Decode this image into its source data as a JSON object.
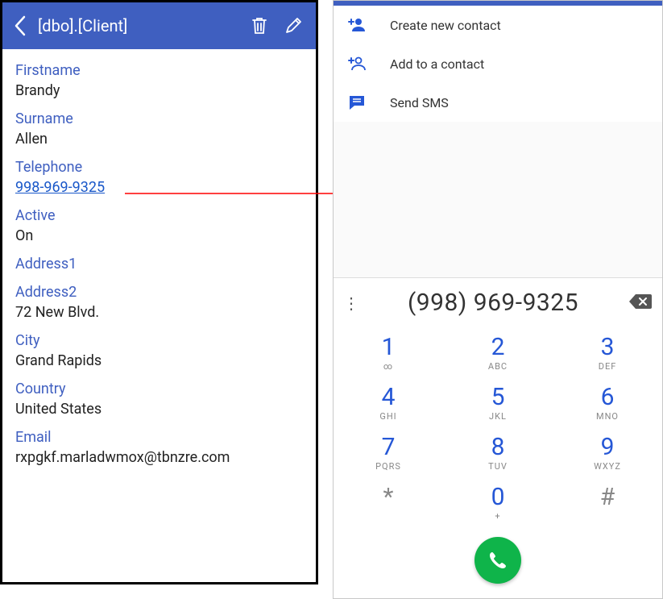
{
  "left": {
    "title": "[dbo].[Client]",
    "fields": {
      "firstname_label": "Firstname",
      "firstname_value": "Brandy",
      "surname_label": "Surname",
      "surname_value": "Allen",
      "telephone_label": "Telephone",
      "telephone_value": "998-969-9325",
      "active_label": "Active",
      "active_value": "On",
      "address1_label": "Address1",
      "address2_label": "Address2",
      "address2_value": "72 New Blvd.",
      "city_label": "City",
      "city_value": "Grand Rapids",
      "country_label": "Country",
      "country_value": "United States",
      "email_label": "Email",
      "email_value": "rxpgkf.marladwmox@tbnzre.com"
    }
  },
  "right": {
    "actions": {
      "create": "Create new contact",
      "add": "Add to a contact",
      "sms": "Send SMS"
    },
    "number": "(998) 969-9325",
    "keys": [
      {
        "num": "1",
        "sub": "∞"
      },
      {
        "num": "2",
        "sub": "ABC"
      },
      {
        "num": "3",
        "sub": "DEF"
      },
      {
        "num": "4",
        "sub": "GHI"
      },
      {
        "num": "5",
        "sub": "JKL"
      },
      {
        "num": "6",
        "sub": "MNO"
      },
      {
        "num": "7",
        "sub": "PQRS"
      },
      {
        "num": "8",
        "sub": "TUV"
      },
      {
        "num": "9",
        "sub": "WXYZ"
      },
      {
        "num": "*",
        "sub": ""
      },
      {
        "num": "0",
        "sub": "+"
      },
      {
        "num": "#",
        "sub": ""
      }
    ]
  }
}
